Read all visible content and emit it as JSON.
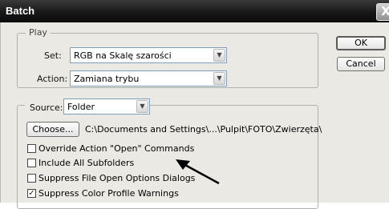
{
  "window": {
    "title": "Batch",
    "close_glyph": "X"
  },
  "play": {
    "legend": "Play",
    "set_label": "Set:",
    "set_value": "RGB na Skalę szarości",
    "action_label": "Action:",
    "action_value": "Zamiana trybu"
  },
  "buttons": {
    "ok": "OK",
    "cancel": "Cancel"
  },
  "source": {
    "label": "Source:",
    "value": "Folder",
    "choose_button": "Choose...",
    "path": "C:\\Documents and Settings\\...\\Pulpit\\FOTO\\Zwierzęta\\",
    "options": [
      {
        "label": "Override Action \"Open\" Commands",
        "checked": false
      },
      {
        "label": "Include All Subfolders",
        "checked": false
      },
      {
        "label": "Suppress File Open Options Dialogs",
        "checked": false
      },
      {
        "label": "Suppress Color Profile Warnings",
        "checked": true
      }
    ]
  },
  "icons": {
    "dropdown": "chevron-down-icon",
    "annotation": "arrow-icon"
  }
}
